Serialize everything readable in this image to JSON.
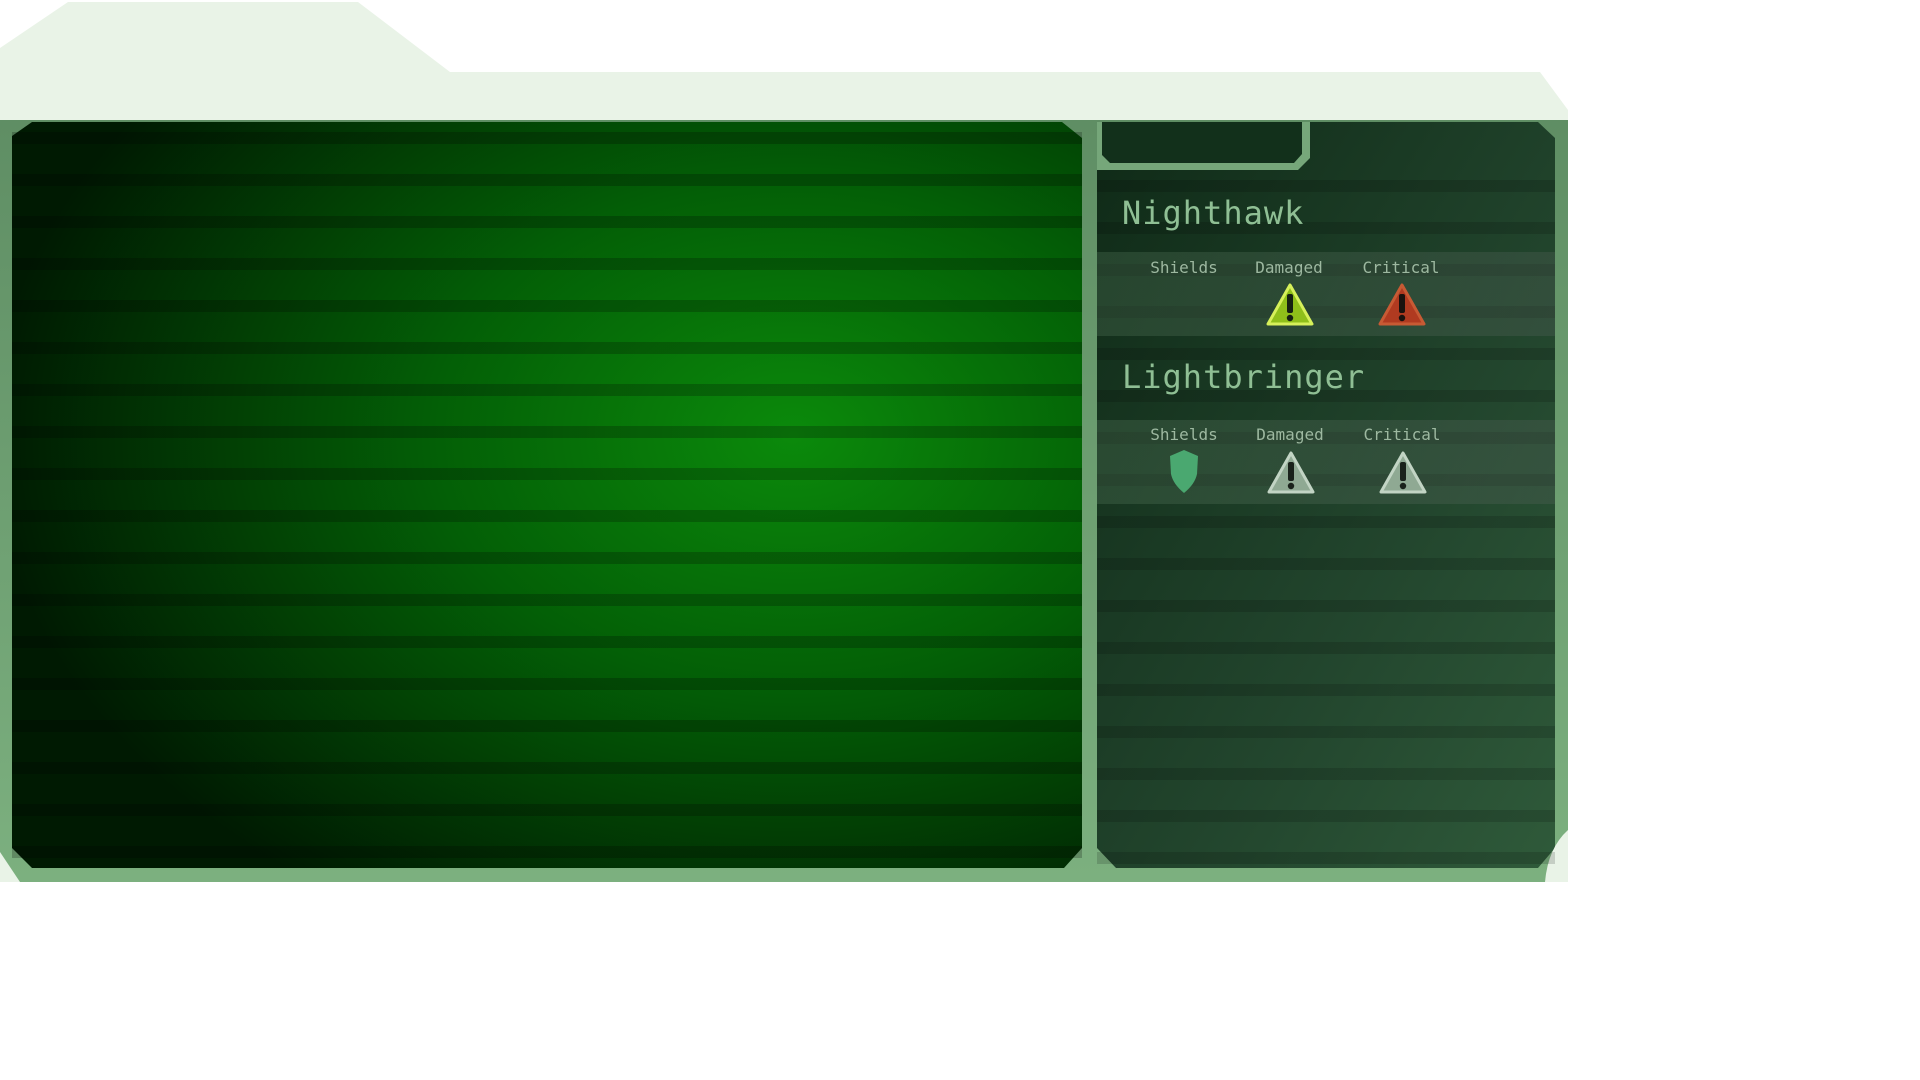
{
  "screen": {
    "colors": {
      "frame": "#e8f3e6",
      "frame_border": "#76a77a",
      "main_screen": "#0a8a0a",
      "panel": "#1f3b28",
      "warning_active": "#8fbf1a",
      "critical_active": "#b03a20",
      "inactive": "#9fb8a3",
      "shield_active": "#4aa870"
    }
  },
  "ships": [
    {
      "name": "Nighthawk",
      "statuses": [
        {
          "label": "Shields",
          "icon": "shield-icon",
          "state": "off"
        },
        {
          "label": "Damaged",
          "icon": "warning-icon",
          "state": "active"
        },
        {
          "label": "Critical",
          "icon": "warning-icon",
          "state": "critical"
        }
      ]
    },
    {
      "name": "Lightbringer",
      "statuses": [
        {
          "label": "Shields",
          "icon": "shield-icon",
          "state": "active"
        },
        {
          "label": "Damaged",
          "icon": "warning-icon",
          "state": "inactive"
        },
        {
          "label": "Critical",
          "icon": "warning-icon",
          "state": "inactive"
        }
      ]
    }
  ]
}
